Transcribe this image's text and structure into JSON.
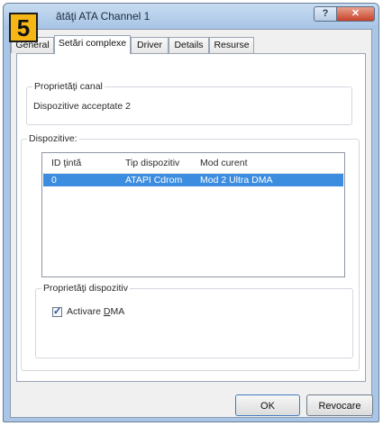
{
  "window": {
    "title": "ătăţi ATA Channel 1"
  },
  "badge": "5",
  "tabs": [
    {
      "label": "General",
      "active": false
    },
    {
      "label": "Setări complexe",
      "active": true
    },
    {
      "label": "Driver",
      "active": false
    },
    {
      "label": "Details",
      "active": false
    },
    {
      "label": "Resurse",
      "active": false
    }
  ],
  "channel_group": {
    "label": "Proprietăţi canal",
    "devices_text": "Dispozitive acceptate 2"
  },
  "devices_group": {
    "label": "Dispozitive:",
    "columns": [
      "ID ţintă",
      "Tip dispozitiv",
      "Mod curent"
    ],
    "rows": [
      {
        "id": "0",
        "type": "ATAPI Cdrom",
        "mode": "Mod 2 Ultra DMA",
        "selected": true
      }
    ]
  },
  "device_props_group": {
    "label": "Proprietăţi dispozitiv",
    "checkbox_prefix": "Activare ",
    "checkbox_accel": "D",
    "checkbox_rest": "MA",
    "checked": true
  },
  "buttons": {
    "ok": "OK",
    "cancel": "Revocare"
  },
  "colors": {
    "selection": "#3c8ddf",
    "badge": "#f6b716",
    "titlebar": "#a9c6e6",
    "close": "#c8422a"
  }
}
